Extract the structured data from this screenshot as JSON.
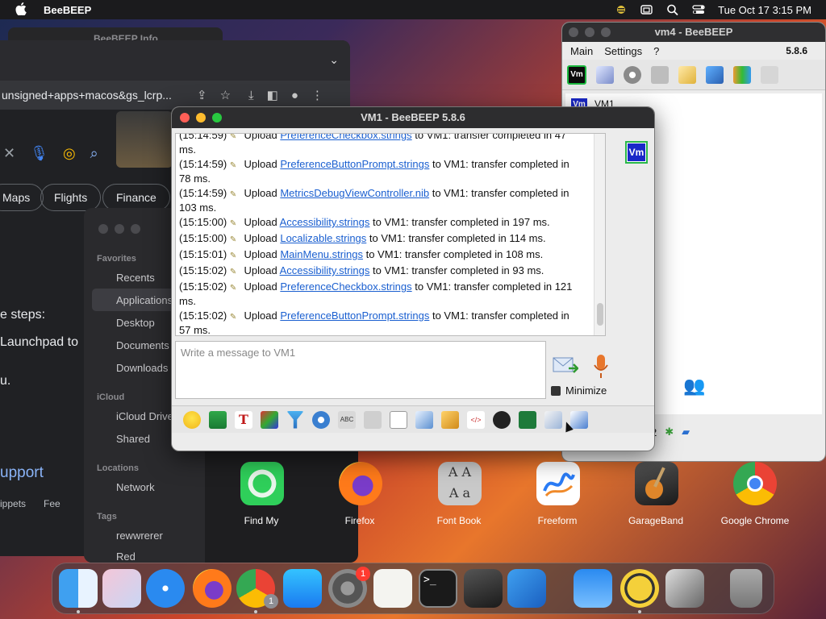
{
  "menubar": {
    "app_name": "BeeBEEP",
    "datetime": "Tue Oct 17  3:15 PM"
  },
  "chrome": {
    "url": "unsigned+apps+macos&gs_lcrp...",
    "chips": [
      "Maps",
      "Flights",
      "Finance"
    ],
    "text_steps": "e steps:",
    "text_launchpad": "Launchpad to",
    "text_u": "u.",
    "link_support": "upport",
    "footer_snippets": "ippets",
    "footer_feedback": "Fee"
  },
  "finder": {
    "favorites_header": "Favorites",
    "favorites": [
      "Recents",
      "Applications",
      "Desktop",
      "Documents",
      "Downloads"
    ],
    "icloud_header": "iCloud",
    "icloud": [
      "iCloud Drive",
      "Shared"
    ],
    "locations_header": "Locations",
    "locations": [
      "Network"
    ],
    "tags_header": "Tags",
    "tags": [
      "rewwrerer",
      "Red"
    ]
  },
  "launchpad": {
    "apps": [
      "Find My",
      "Firefox",
      "Font Book",
      "Freeform",
      "GarageBand",
      "Google Chrome"
    ]
  },
  "background_title": "BeeBEEP Info",
  "vm4": {
    "title": "vm4 - BeeBEEP",
    "version": "5.8.6",
    "menu": [
      "Main",
      "Settings",
      "?"
    ],
    "user_label": "VM1",
    "status_count": "2"
  },
  "vm1": {
    "title": "VM1 - BeeBEEP 5.8.6",
    "user_tag": "Vm",
    "messages": [
      {
        "time": "(15:14:59)",
        "action": "Upload",
        "file": "PreferenceCheckbox.strings",
        "tail": "to VM1: transfer completed in 47",
        "tail2": "ms."
      },
      {
        "time": "(15:14:59)",
        "action": "Upload",
        "file": "PreferenceButtonPrompt.strings",
        "tail": "to VM1: transfer completed in",
        "tail2": "78 ms."
      },
      {
        "time": "(15:14:59)",
        "action": "Upload",
        "file": "MetricsDebugViewController.nib",
        "tail": "to VM1: transfer completed in",
        "tail2": "103 ms."
      },
      {
        "time": "(15:15:00)",
        "action": "Upload",
        "file": "Accessibility.strings",
        "tail": "to VM1: transfer completed in 197 ms.",
        "tail2": ""
      },
      {
        "time": "(15:15:00)",
        "action": "Upload",
        "file": "Localizable.strings",
        "tail": "to VM1: transfer completed in 114 ms.",
        "tail2": ""
      },
      {
        "time": "(15:15:01)",
        "action": "Upload",
        "file": "MainMenu.strings",
        "tail": "to VM1: transfer completed in 108 ms.",
        "tail2": ""
      },
      {
        "time": "(15:15:02)",
        "action": "Upload",
        "file": "Accessibility.strings",
        "tail": "to VM1: transfer completed in 93 ms.",
        "tail2": ""
      },
      {
        "time": "(15:15:02)",
        "action": "Upload",
        "file": "PreferenceCheckbox.strings",
        "tail": "to VM1: transfer completed in 121",
        "tail2": "ms."
      },
      {
        "time": "(15:15:02)",
        "action": "Upload",
        "file": "PreferenceButtonPrompt.strings",
        "tail": "to VM1: transfer completed in",
        "tail2": "57 ms."
      }
    ],
    "input_placeholder": "Write a message to VM1",
    "minimize_label": "Minimize"
  },
  "dock": {
    "settings_badge": "1",
    "chrome_badge": "1"
  }
}
